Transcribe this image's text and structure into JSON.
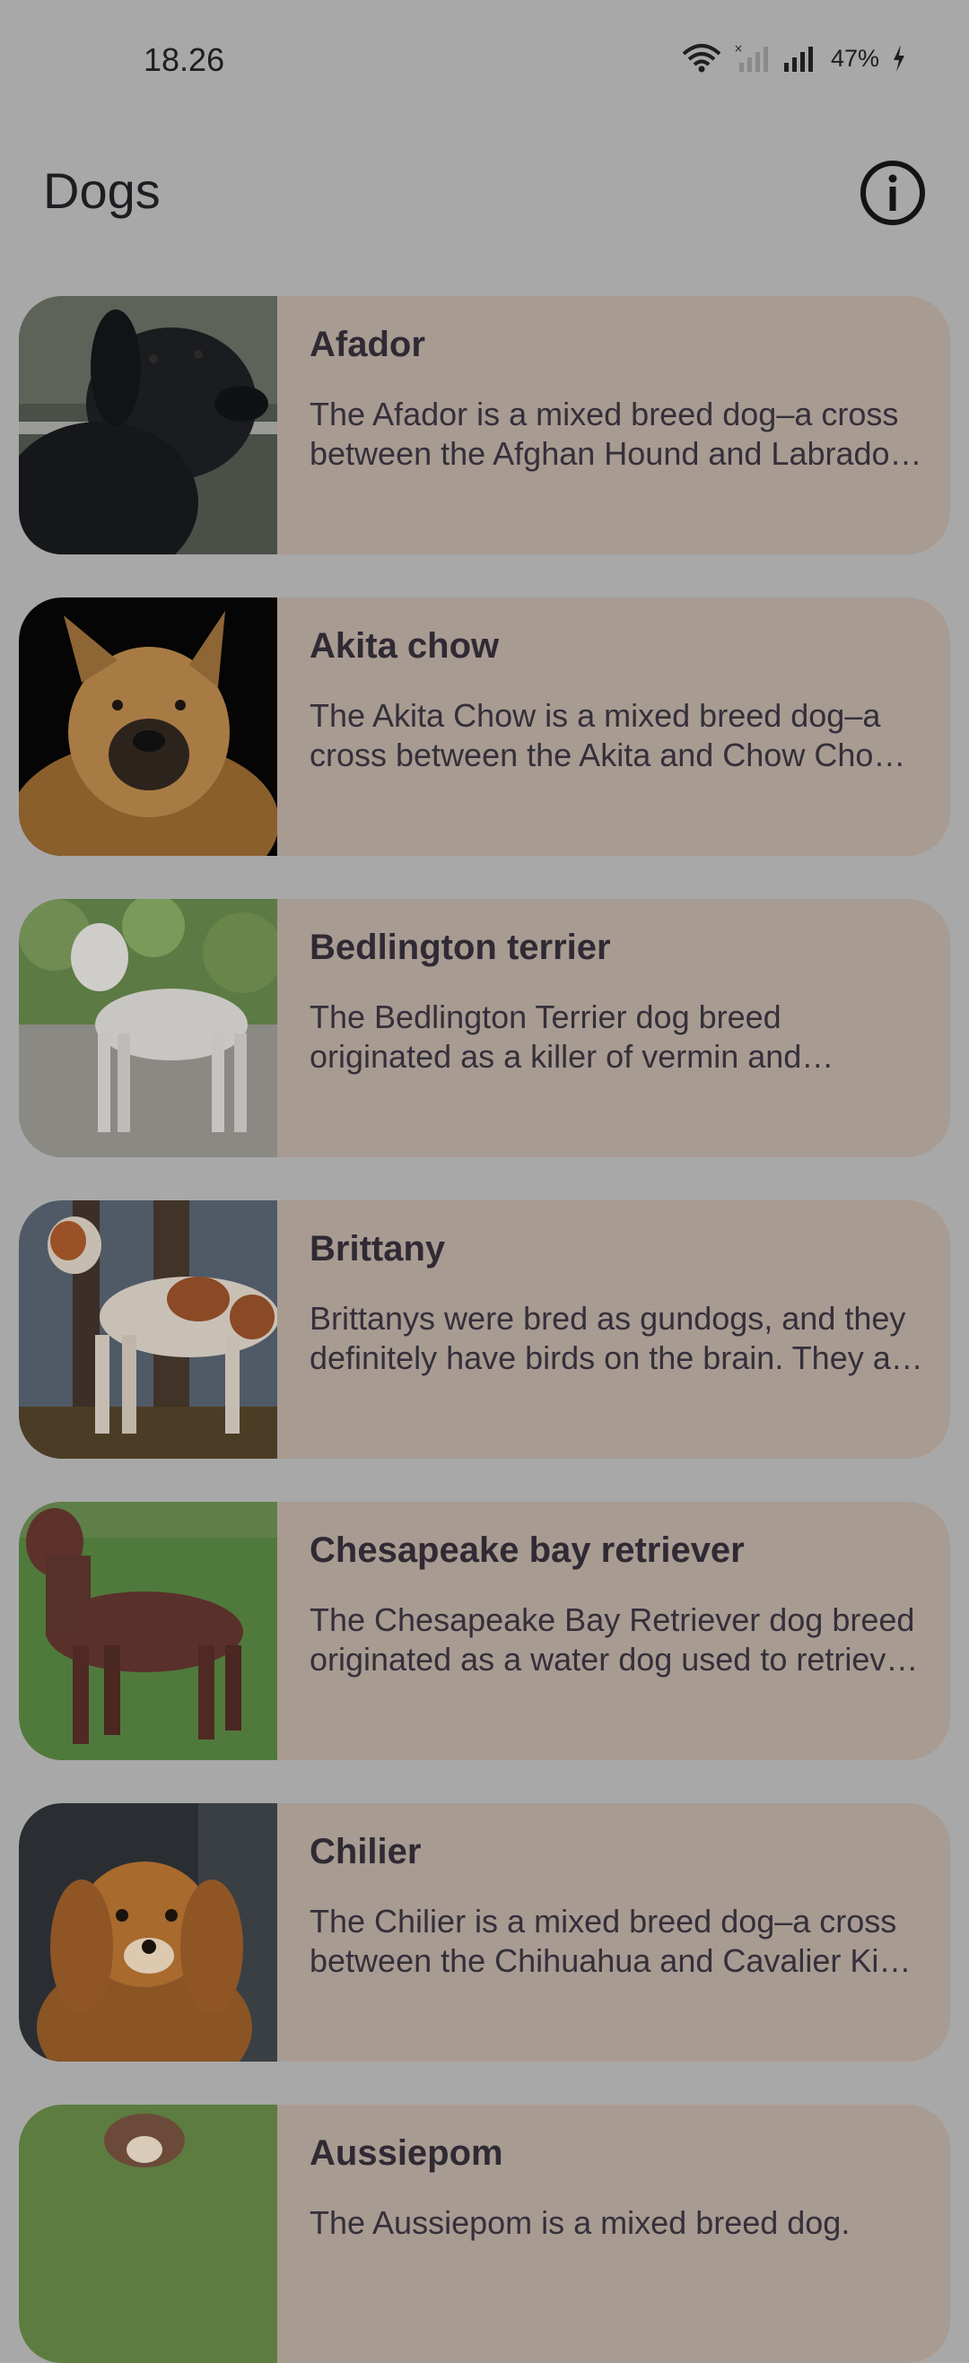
{
  "status_bar": {
    "time": "18.26",
    "battery": "47%",
    "icons": [
      "wifi-icon",
      "no-signal-icon",
      "signal-icon",
      "charging-icon"
    ]
  },
  "app_bar": {
    "title": "Dogs",
    "info_icon": "info-icon"
  },
  "dogs": [
    {
      "name": "Afador",
      "description": "The Afador is a mixed breed dog–a cross between the Afghan Hound and Labrador Retriever breeds.",
      "image": "black-labrador-photo"
    },
    {
      "name": "Akita chow",
      "description": "The Akita Chow is a mixed breed dog–a cross between the Akita and Chow Chow dog breeds.",
      "image": "akita-chow-photo"
    },
    {
      "name": "Bedlington terrier",
      "description": "The Bedlington Terrier dog breed originated as a killer of vermin and poachers' companion.",
      "image": "bedlington-terrier-photo"
    },
    {
      "name": "Brittany",
      "description": "Brittanys were bred as gundogs, and they definitely have birds on the brain. They are athletic dogs.",
      "image": "brittany-photo"
    },
    {
      "name": "Chesapeake bay retriever",
      "description": "The Chesapeake Bay Retriever dog breed originated as a water dog used to retrieve ducks.",
      "image": "chesapeake-retriever-photo"
    },
    {
      "name": "Chilier",
      "description": "The Chilier is a mixed breed dog–a cross between the Chihuahua and Cavalier King Charles Spaniel.",
      "image": "chilier-photo"
    },
    {
      "name": "Aussiepom",
      "description": "The Aussiepom is a mixed breed dog.",
      "image": "aussiepom-photo"
    }
  ]
}
